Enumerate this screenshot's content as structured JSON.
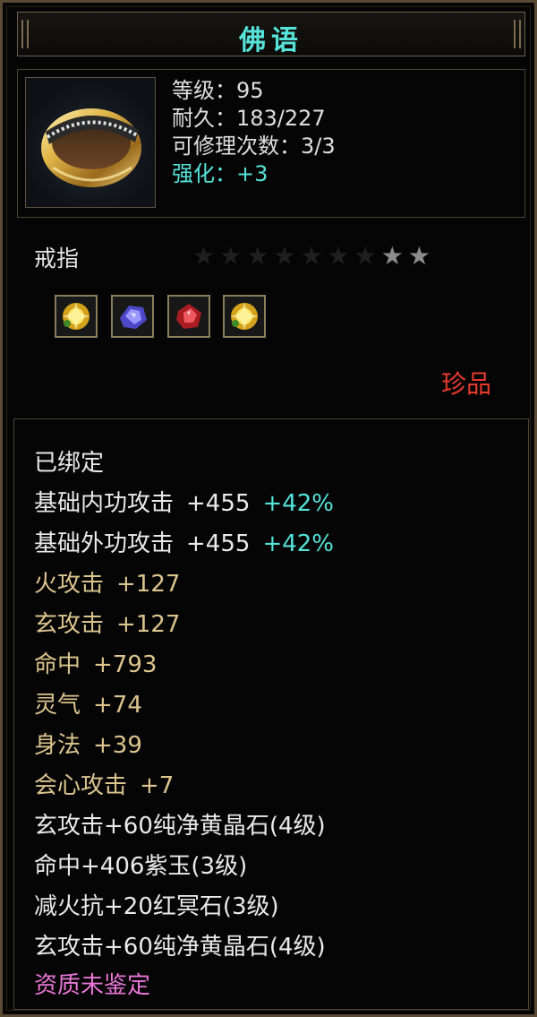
{
  "title": "佛语",
  "item": {
    "icon": "gold-ring-icon",
    "stats": [
      {
        "label": "等级：95",
        "color": "white"
      },
      {
        "label": "耐久：183/227",
        "color": "white"
      },
      {
        "label": "可修理次数：3/3",
        "color": "white"
      },
      {
        "label": "强化：+3",
        "color": "cyan"
      }
    ],
    "category": "戒指",
    "stars": {
      "total": 9,
      "lit": 2
    },
    "gems": [
      {
        "icon": "yellow-crystal-gem-icon"
      },
      {
        "icon": "purple-jade-gem-icon"
      },
      {
        "icon": "red-stone-gem-icon"
      },
      {
        "icon": "yellow-crystal-gem-icon"
      }
    ],
    "rarity": "珍品"
  },
  "attributes": {
    "bound": "已绑定",
    "base": [
      {
        "name": "基础内功攻击",
        "value": "+455",
        "percent": "+42%"
      },
      {
        "name": "基础外功攻击",
        "value": "+455",
        "percent": "+42%"
      }
    ],
    "bonus": [
      {
        "name": "火攻击",
        "value": "+127"
      },
      {
        "name": "玄攻击",
        "value": "+127"
      },
      {
        "name": "命中",
        "value": "+793"
      },
      {
        "name": "灵气",
        "value": "+74"
      },
      {
        "name": "身法",
        "value": "+39"
      },
      {
        "name": "会心攻击",
        "value": "+7"
      }
    ],
    "gem_effects": [
      "玄攻击+60纯净黄晶石(4级)",
      "命中+406紫玉(3级)",
      "减火抗+20红冥石(3级)",
      "玄攻击+60纯净黄晶石(4级)"
    ],
    "quality": "资质未鉴定"
  },
  "colors": {
    "title": "#55e3d9",
    "enhance": "#55e3d9",
    "rarity": "#e63b2e",
    "bonus": "#dcc48e",
    "quality": "#e875d6"
  }
}
